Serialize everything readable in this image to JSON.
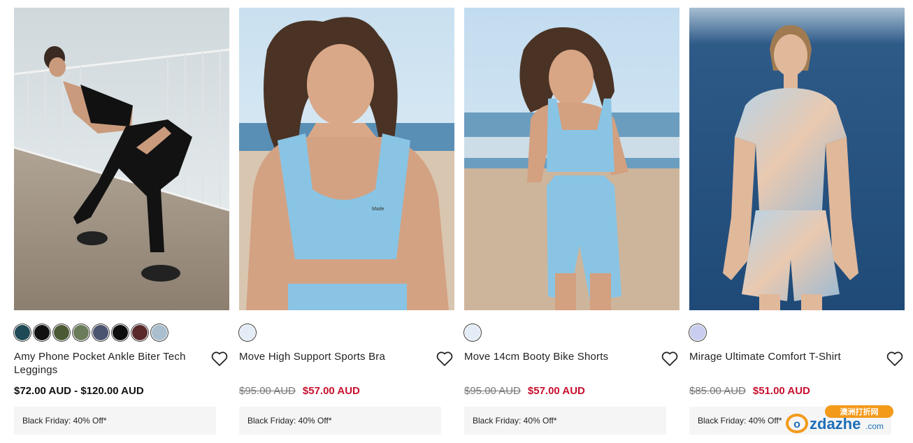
{
  "products": [
    {
      "name": "Amy Phone Pocket Ankle Biter Tech Leggings",
      "price_range": "$72.00 AUD - $120.00 AUD",
      "promo": "Black Friday: 40% Off*",
      "swatches": [
        "#1f4a55",
        "#111111",
        "#4b5a35",
        "#6b7c5a",
        "#4c5570",
        "#0d0d0d",
        "#5a2a2a",
        "#a9bfcf"
      ]
    },
    {
      "name": "Move High Support Sports Bra",
      "original_price": "$95.00 AUD",
      "sale_price": "$57.00 AUD",
      "promo": "Black Friday: 40% Off*",
      "swatches": [
        "#e4ecf7"
      ]
    },
    {
      "name": "Move 14cm Booty Bike Shorts",
      "original_price": "$95.00 AUD",
      "sale_price": "$57.00 AUD",
      "promo": "Black Friday: 40% Off*",
      "swatches": [
        "#e4ecf7"
      ]
    },
    {
      "name": "Mirage Ultimate Comfort T-Shirt",
      "original_price": "$85.00 AUD",
      "sale_price": "$51.00 AUD",
      "promo": "Black Friday: 40% Off*",
      "swatches": [
        "#c9cdf0"
      ]
    }
  ],
  "watermark": {
    "brand": "ozdazhe",
    "domain": ".com",
    "tag": "澳洲打折网"
  },
  "colors": {
    "sale": "#c8102e",
    "promo_bg": "#f5f5f5"
  },
  "icons": {
    "wishlist": "heart-outline-icon"
  }
}
